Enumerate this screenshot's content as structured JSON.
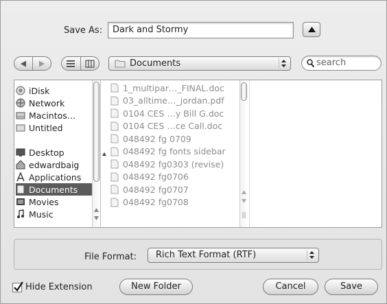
{
  "save_as": {
    "label": "Save As:",
    "value": "Dark and Stormy"
  },
  "toolbar": {
    "back_icon": "back-arrow-icon",
    "forward_icon": "forward-arrow-icon",
    "list_view_icon": "list-view-icon",
    "column_view_icon": "column-view-icon",
    "location": "Documents",
    "search_placeholder": "search"
  },
  "sidebar": {
    "items": [
      {
        "label": "iDisk",
        "icon": "idisk-icon"
      },
      {
        "label": "Network",
        "icon": "network-icon"
      },
      {
        "label": "Macintos…",
        "icon": "hard-drive-icon"
      },
      {
        "label": "Untitled",
        "icon": "disk-icon"
      },
      {
        "label": "Desktop",
        "icon": "desktop-icon"
      },
      {
        "label": "edwardbaig",
        "icon": "home-icon"
      },
      {
        "label": "Applications",
        "icon": "applications-icon"
      },
      {
        "label": "Documents",
        "icon": "documents-icon",
        "selected": true
      },
      {
        "label": "Movies",
        "icon": "movies-icon"
      },
      {
        "label": "Music",
        "icon": "music-icon"
      }
    ]
  },
  "files": [
    "1_multipar…_FINAL.doc",
    "03_alltime…_jordan.pdf",
    "0104 CES …y Bill G.doc",
    "0104 CES …ce Call.doc",
    "048492 fg 0709",
    "048492 fg fonts sidebar",
    "048492 fg0303 (revise)",
    "048492 fg0706",
    "048492 fg0707",
    "048492 fg0708"
  ],
  "format": {
    "label": "File Format:",
    "value": "Rich Text Format (RTF)"
  },
  "bottom": {
    "hide_extension": "Hide Extension",
    "hide_extension_checked": true,
    "new_folder": "New Folder",
    "cancel": "Cancel",
    "save": "Save"
  }
}
